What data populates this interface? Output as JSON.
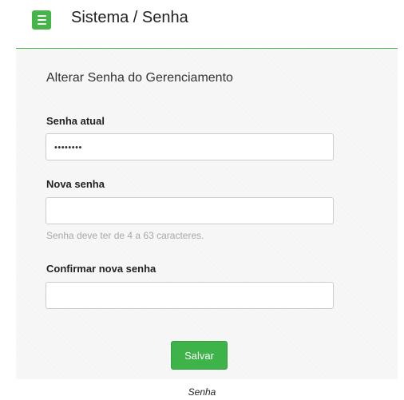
{
  "header": {
    "menu_icon": "hamburger-menu-icon",
    "title": "Sistema / Senha"
  },
  "form": {
    "section_title": "Alterar Senha do Gerenciamento",
    "current_password": {
      "label": "Senha atual",
      "value": "••••••••",
      "placeholder": ""
    },
    "new_password": {
      "label": "Nova senha",
      "value": "",
      "placeholder": "",
      "help": "Senha deve ter de 4 a 63 caracteres."
    },
    "confirm_password": {
      "label": "Confirmar nova senha",
      "value": "",
      "placeholder": ""
    },
    "save_label": "Salvar"
  },
  "caption": "Senha",
  "colors": {
    "accent": "#45b549",
    "button": "#3db34a",
    "panel_bg": "#f7f7f7",
    "help_text": "#a8a8a8"
  }
}
